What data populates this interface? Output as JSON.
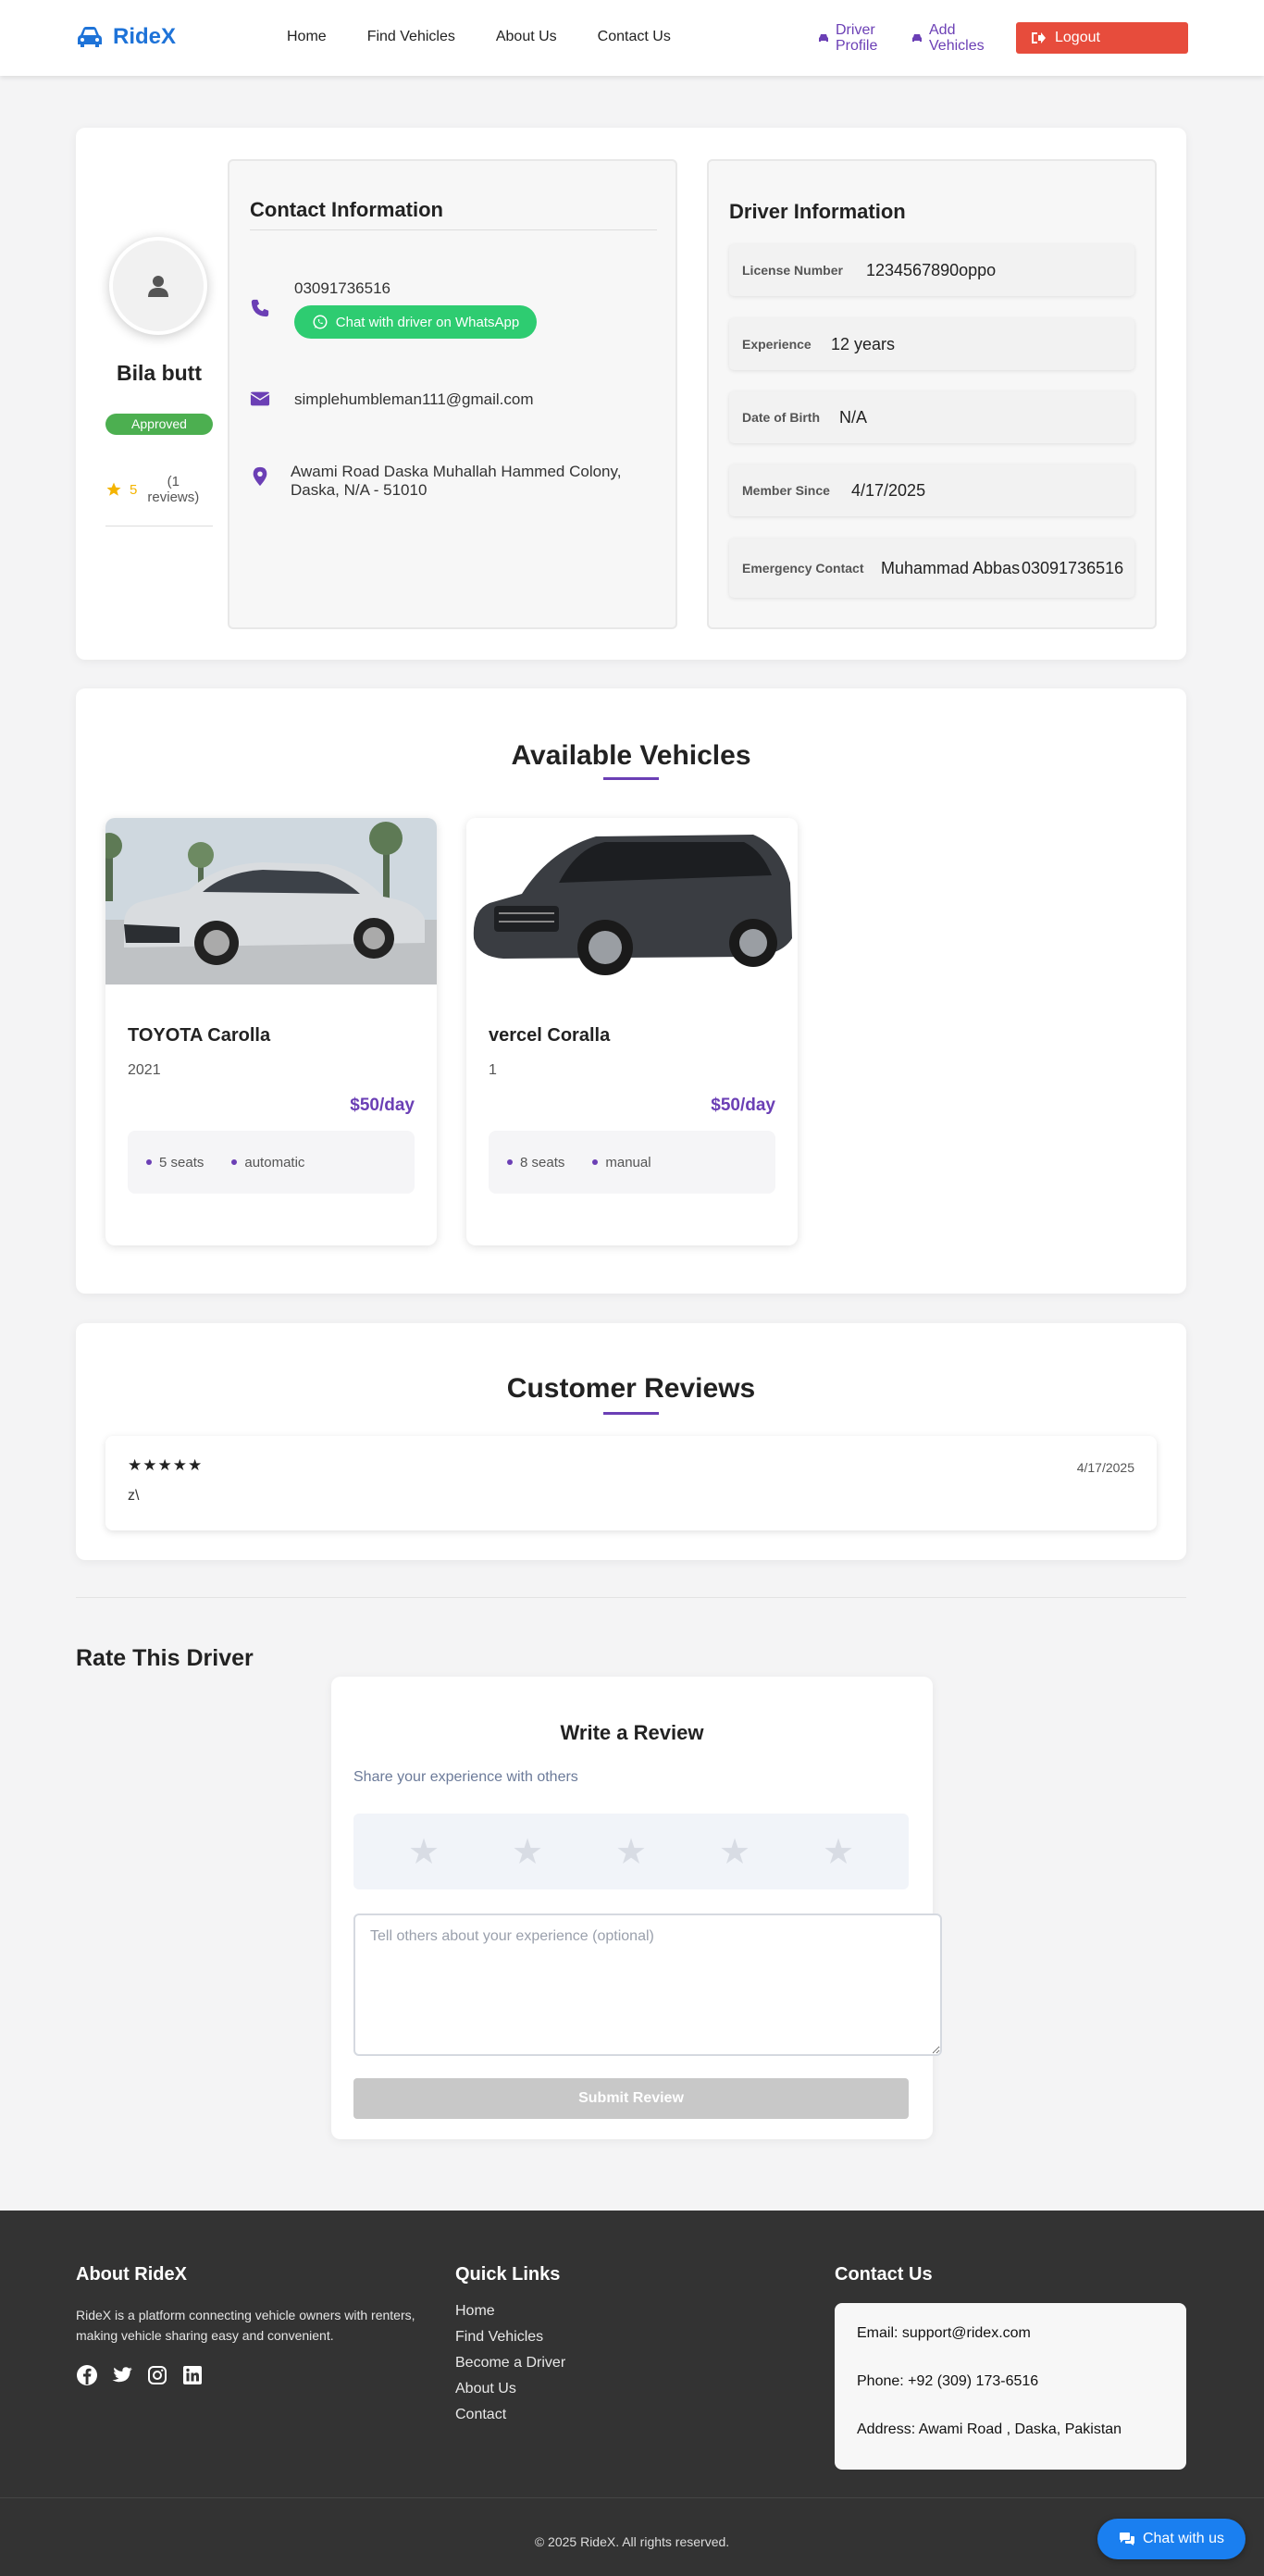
{
  "brand": {
    "name": "RideX",
    "icon": "car-icon"
  },
  "nav": {
    "links": [
      "Home",
      "Find Vehicles",
      "About Us",
      "Contact Us"
    ],
    "driver_profile": "Driver Profile",
    "add_vehicles": "Add Vehicles",
    "logout": "Logout"
  },
  "profile": {
    "name": "Bila butt",
    "status": "Approved",
    "rating": "5",
    "review_count": "(1 reviews)"
  },
  "contact": {
    "title": "Contact Information",
    "phone": "03091736516",
    "whatsapp_label": "Chat with driver on WhatsApp",
    "email": "simplehumbleman111@gmail.com",
    "address": "Awami Road Daska Muhallah Hammed Colony, Daska, N/A - 51010"
  },
  "driver_info": {
    "title": "Driver Information",
    "rows": [
      {
        "label": "License Number",
        "value": "1234567890oppo"
      },
      {
        "label": "Experience",
        "value": "12 years"
      },
      {
        "label": "Date of Birth",
        "value": "N/A"
      },
      {
        "label": "Member Since",
        "value": "4/17/2025"
      },
      {
        "label": "Emergency Contact",
        "value": "Muhammad Abbas",
        "extra": "03091736516"
      }
    ]
  },
  "vehicles": {
    "title": "Available Vehicles",
    "items": [
      {
        "name": "TOYOTA Carolla",
        "year": "2021",
        "price": "$50/day",
        "seats": "5 seats",
        "transmission": "automatic",
        "color": "#c9cdd2"
      },
      {
        "name": "vercel Coralla",
        "year": "1",
        "price": "$50/day",
        "seats": "8 seats",
        "transmission": "manual",
        "color": "#3a3d42"
      }
    ]
  },
  "reviews": {
    "title": "Customer Reviews",
    "items": [
      {
        "stars": "★★★★★",
        "date": "4/17/2025",
        "text": "z\\"
      }
    ]
  },
  "rate": {
    "heading": "Rate This Driver",
    "title": "Write a Review",
    "subtitle": "Share your experience with others",
    "placeholder": "Tell others about your experience (optional)",
    "submit": "Submit Review",
    "star_count": 5
  },
  "footer": {
    "about_title": "About RideX",
    "about_text": "RideX is a platform connecting vehicle owners with renters, making vehicle sharing easy and convenient.",
    "links_title": "Quick Links",
    "links": [
      "Home",
      "Find Vehicles",
      "Become a Driver",
      "About Us",
      "Contact"
    ],
    "contact_title": "Contact Us",
    "email": "Email: support@ridex.com",
    "phone": "Phone: +92 (309) 173-6516",
    "address": "Address: Awami Road , Daska, Pakistan",
    "copyright": "© 2025 RideX. All rights reserved.",
    "social": [
      "facebook-icon",
      "twitter-icon",
      "instagram-icon",
      "linkedin-icon"
    ]
  },
  "chat": {
    "label": "Chat with us"
  },
  "colors": {
    "accent": "#6b3fb5",
    "brand": "#1e73d8",
    "logout": "#e74c3c",
    "whatsapp": "#2ecc71",
    "approved": "#4caf50",
    "footer": "#333333",
    "chat": "#1a7ff0"
  }
}
